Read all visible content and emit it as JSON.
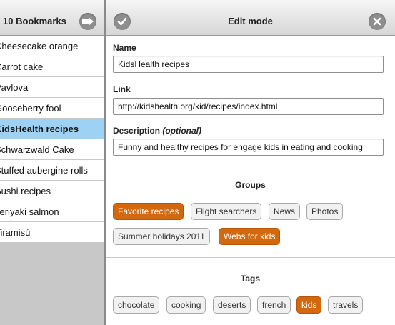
{
  "sidebar": {
    "title": "10 Bookmarks",
    "forward_icon": "arrow-right-icon",
    "items": [
      {
        "label": "Cheesecake orange",
        "selected": false
      },
      {
        "label": "Carrot cake",
        "selected": false
      },
      {
        "label": "Pavlova",
        "selected": false
      },
      {
        "label": "Gooseberry fool",
        "selected": false
      },
      {
        "label": "KidsHealth recipes",
        "selected": true
      },
      {
        "label": "Schwarzwald Cake",
        "selected": false
      },
      {
        "label": "Stuffed aubergine rolls",
        "selected": false
      },
      {
        "label": "Sushi recipes",
        "selected": false
      },
      {
        "label": "Teriyaki salmon",
        "selected": false
      },
      {
        "label": "Tiramisú",
        "selected": false
      }
    ]
  },
  "header": {
    "title": "Edit mode",
    "confirm_icon": "checkmark-icon",
    "close_icon": "close-icon"
  },
  "form": {
    "name_label": "Name",
    "name_value": "KidsHealth recipes",
    "link_label": "Link",
    "link_value": "http://kidshealth.org/kid/recipes/index.html",
    "description_label": "Description",
    "description_hint": "(optional)",
    "description_value": "Funny and healthy recipes for engage kids in eating and cooking"
  },
  "groups": {
    "title": "Groups",
    "items": [
      {
        "label": "Favorite recipes",
        "active": true
      },
      {
        "label": "Flight searchers",
        "active": false
      },
      {
        "label": "News",
        "active": false
      },
      {
        "label": "Photos",
        "active": false
      },
      {
        "label": "Summer holidays 2011",
        "active": false
      },
      {
        "label": "Webs for kids",
        "active": true
      }
    ]
  },
  "tags": {
    "title": "Tags",
    "items": [
      {
        "label": "chocolate",
        "active": false
      },
      {
        "label": "cooking",
        "active": false
      },
      {
        "label": "deserts",
        "active": false
      },
      {
        "label": "french",
        "active": false
      },
      {
        "label": "kids",
        "active": true
      },
      {
        "label": "travels",
        "active": false
      }
    ]
  },
  "colors": {
    "accent": "#d2690e",
    "selection": "#9ed2f5",
    "chip_bg": "#f1f1f1"
  }
}
